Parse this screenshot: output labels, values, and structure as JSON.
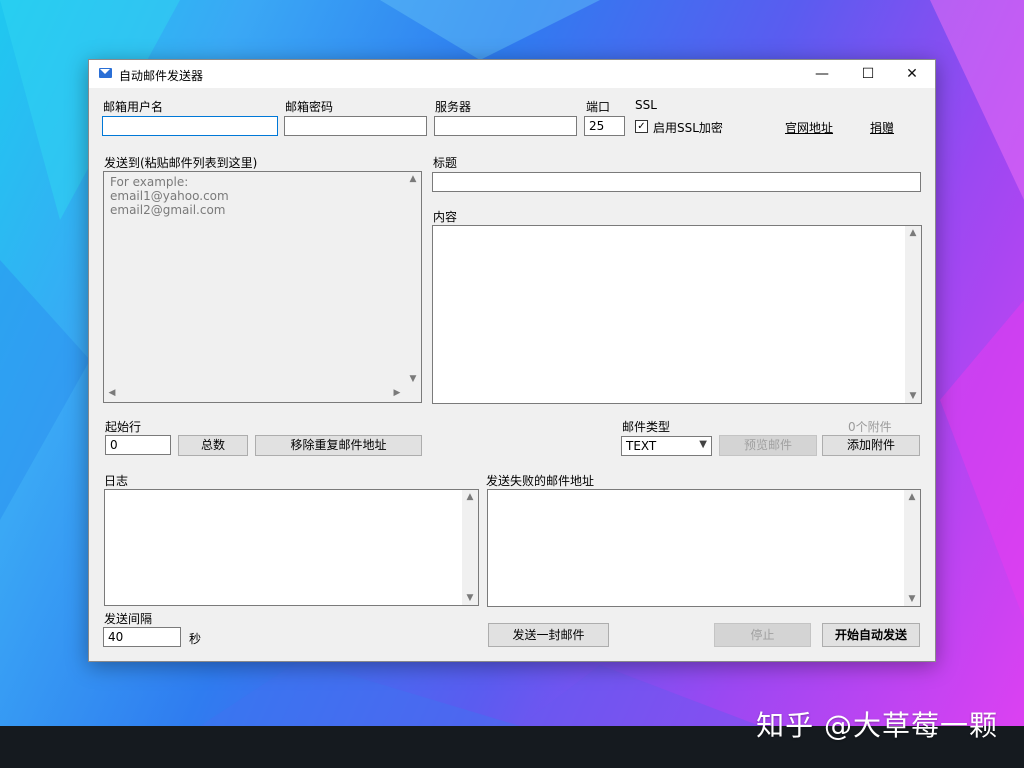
{
  "window": {
    "title": "自动邮件发送器",
    "min": "—",
    "max": "☐",
    "close": "✕"
  },
  "fields": {
    "username_label": "邮箱用户名",
    "username_value": "",
    "password_label": "邮箱密码",
    "password_value": "",
    "server_label": "服务器",
    "server_value": "",
    "port_label": "端口",
    "port_value": "25",
    "ssl_label": "SSL",
    "ssl_checkbox_label": "启用SSL加密",
    "ssl_checked": true
  },
  "links": {
    "website": "官网地址",
    "donate": "捐赠"
  },
  "recipients": {
    "label": "发送到(粘贴邮件列表到这里)",
    "placeholder": "For example:\nemail1@yahoo.com\nemail2@gmail.com"
  },
  "subject": {
    "label": "标题",
    "value": ""
  },
  "content": {
    "label": "内容"
  },
  "controls": {
    "start_row_label": "起始行",
    "start_row_value": "0",
    "total_button": "总数",
    "dedupe_button": "移除重复邮件地址",
    "mail_type_label": "邮件类型",
    "mail_type_value": "TEXT",
    "attachments_count": "0个附件",
    "preview_button": "预览邮件",
    "add_attachment_button": "添加附件"
  },
  "log": {
    "label": "日志"
  },
  "failed": {
    "label": "发送失败的邮件地址"
  },
  "interval": {
    "label": "发送间隔",
    "value": "40",
    "unit": "秒"
  },
  "actions": {
    "send_one": "发送一封邮件",
    "stop": "停止",
    "start_auto": "开始自动发送"
  },
  "watermark": "知乎 @大草莓一颗"
}
